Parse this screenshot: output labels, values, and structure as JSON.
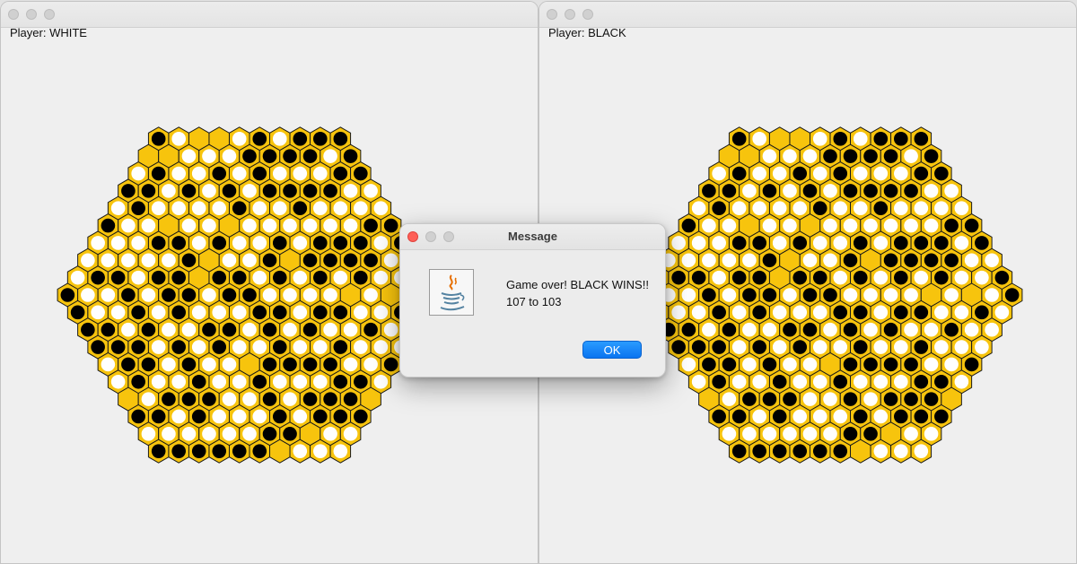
{
  "windows": [
    {
      "player_label": "Player: WHITE"
    },
    {
      "player_label": "Player: BLACK"
    }
  ],
  "board": {
    "radius": 9,
    "colors": {
      "cell": "#f7c40d",
      "cell_border": "#1a1a1a",
      "white_piece": "#ffffff",
      "black_piece": "#000000"
    }
  },
  "dialog": {
    "title": "Message",
    "icon": "java-coffee-cup-icon",
    "message_line1": "Game over! BLACK WINS!!",
    "message_line2": "107 to 103",
    "ok_label": "OK",
    "button_color": "#0a74f0"
  }
}
